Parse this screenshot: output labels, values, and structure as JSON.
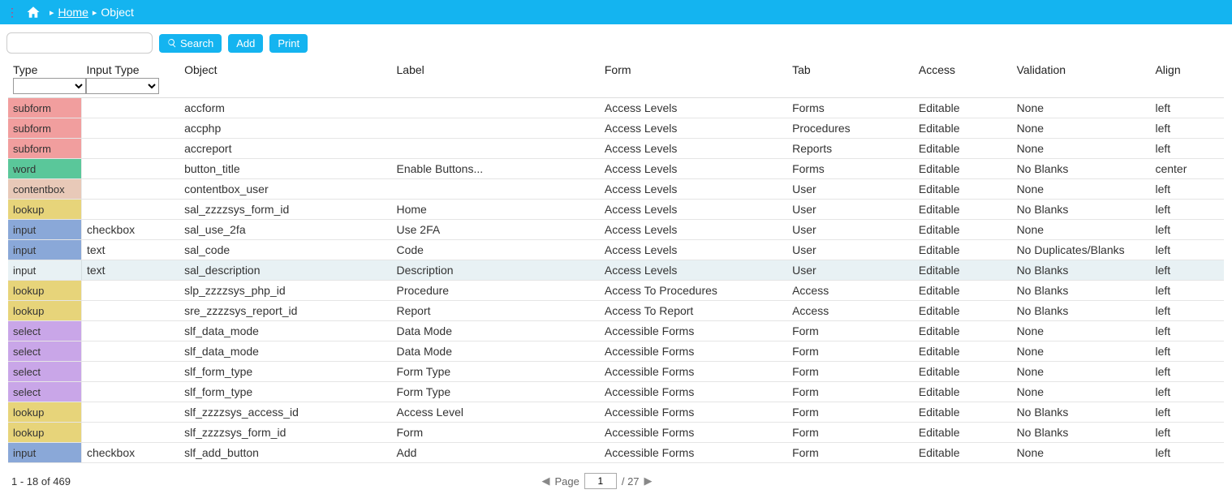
{
  "topbar": {
    "home_label": "Home",
    "current_label": "Object",
    "sep": "▸"
  },
  "toolbar": {
    "search_label": "Search",
    "add_label": "Add",
    "print_label": "Print",
    "search_placeholder": ""
  },
  "columns": {
    "type": "Type",
    "input_type": "Input Type",
    "object": "Object",
    "label": "Label",
    "form": "Form",
    "tab": "Tab",
    "access": "Access",
    "validation": "Validation",
    "align": "Align"
  },
  "rows": [
    {
      "type": "subform",
      "typeClass": "t-subform",
      "input_type": "",
      "object": "accform",
      "label": "",
      "form": "Access Levels",
      "tab": "Forms",
      "access": "Editable",
      "validation": "None",
      "align": "left"
    },
    {
      "type": "subform",
      "typeClass": "t-subform",
      "input_type": "",
      "object": "accphp",
      "label": "",
      "form": "Access Levels",
      "tab": "Procedures",
      "access": "Editable",
      "validation": "None",
      "align": "left"
    },
    {
      "type": "subform",
      "typeClass": "t-subform",
      "input_type": "",
      "object": "accreport",
      "label": "",
      "form": "Access Levels",
      "tab": "Reports",
      "access": "Editable",
      "validation": "None",
      "align": "left"
    },
    {
      "type": "word",
      "typeClass": "t-word",
      "input_type": "",
      "object": "button_title",
      "label": "Enable Buttons...",
      "form": "Access Levels",
      "tab": "Forms",
      "access": "Editable",
      "validation": "No Blanks",
      "align": "center"
    },
    {
      "type": "contentbox",
      "typeClass": "t-contentbox",
      "input_type": "",
      "object": "contentbox_user",
      "label": "",
      "form": "Access Levels",
      "tab": "User",
      "access": "Editable",
      "validation": "None",
      "align": "left"
    },
    {
      "type": "lookup",
      "typeClass": "t-lookup",
      "input_type": "",
      "object": "sal_zzzzsys_form_id",
      "label": "Home",
      "form": "Access Levels",
      "tab": "User",
      "access": "Editable",
      "validation": "No Blanks",
      "align": "left"
    },
    {
      "type": "input",
      "typeClass": "t-input",
      "input_type": "checkbox",
      "object": "sal_use_2fa",
      "label": "Use 2FA",
      "form": "Access Levels",
      "tab": "User",
      "access": "Editable",
      "validation": "None",
      "align": "left"
    },
    {
      "type": "input",
      "typeClass": "t-input",
      "input_type": "text",
      "object": "sal_code",
      "label": "Code",
      "form": "Access Levels",
      "tab": "User",
      "access": "Editable",
      "validation": "No Duplicates/Blanks",
      "align": "left"
    },
    {
      "type": "input",
      "typeClass": "t-input",
      "input_type": "text",
      "object": "sal_description",
      "label": "Description",
      "form": "Access Levels",
      "tab": "User",
      "access": "Editable",
      "validation": "No Blanks",
      "align": "left",
      "highlight": true
    },
    {
      "type": "lookup",
      "typeClass": "t-lookup",
      "input_type": "",
      "object": "slp_zzzzsys_php_id",
      "label": "Procedure",
      "form": "Access To Procedures",
      "tab": "Access",
      "access": "Editable",
      "validation": "No Blanks",
      "align": "left"
    },
    {
      "type": "lookup",
      "typeClass": "t-lookup",
      "input_type": "",
      "object": "sre_zzzzsys_report_id",
      "label": "Report",
      "form": "Access To Report",
      "tab": "Access",
      "access": "Editable",
      "validation": "No Blanks",
      "align": "left"
    },
    {
      "type": "select",
      "typeClass": "t-select",
      "input_type": "",
      "object": "slf_data_mode",
      "label": "Data Mode",
      "form": "Accessible Forms",
      "tab": "Form",
      "access": "Editable",
      "validation": "None",
      "align": "left"
    },
    {
      "type": "select",
      "typeClass": "t-select",
      "input_type": "",
      "object": "slf_data_mode",
      "label": "Data Mode",
      "form": "Accessible Forms",
      "tab": "Form",
      "access": "Editable",
      "validation": "None",
      "align": "left"
    },
    {
      "type": "select",
      "typeClass": "t-select",
      "input_type": "",
      "object": "slf_form_type",
      "label": "Form Type",
      "form": "Accessible Forms",
      "tab": "Form",
      "access": "Editable",
      "validation": "None",
      "align": "left"
    },
    {
      "type": "select",
      "typeClass": "t-select",
      "input_type": "",
      "object": "slf_form_type",
      "label": "Form Type",
      "form": "Accessible Forms",
      "tab": "Form",
      "access": "Editable",
      "validation": "None",
      "align": "left"
    },
    {
      "type": "lookup",
      "typeClass": "t-lookup",
      "input_type": "",
      "object": "slf_zzzzsys_access_id",
      "label": "Access Level",
      "form": "Accessible Forms",
      "tab": "Form",
      "access": "Editable",
      "validation": "No Blanks",
      "align": "left"
    },
    {
      "type": "lookup",
      "typeClass": "t-lookup",
      "input_type": "",
      "object": "slf_zzzzsys_form_id",
      "label": "Form",
      "form": "Accessible Forms",
      "tab": "Form",
      "access": "Editable",
      "validation": "No Blanks",
      "align": "left"
    },
    {
      "type": "input",
      "typeClass": "t-input",
      "input_type": "checkbox",
      "object": "slf_add_button",
      "label": "Add",
      "form": "Accessible Forms",
      "tab": "Form",
      "access": "Editable",
      "validation": "None",
      "align": "left"
    }
  ],
  "footer": {
    "range_text": "1 - 18 of 469",
    "page_label": "Page",
    "page_value": "1",
    "total_pages": "/ 27",
    "prev": "◀",
    "next": "▶"
  }
}
